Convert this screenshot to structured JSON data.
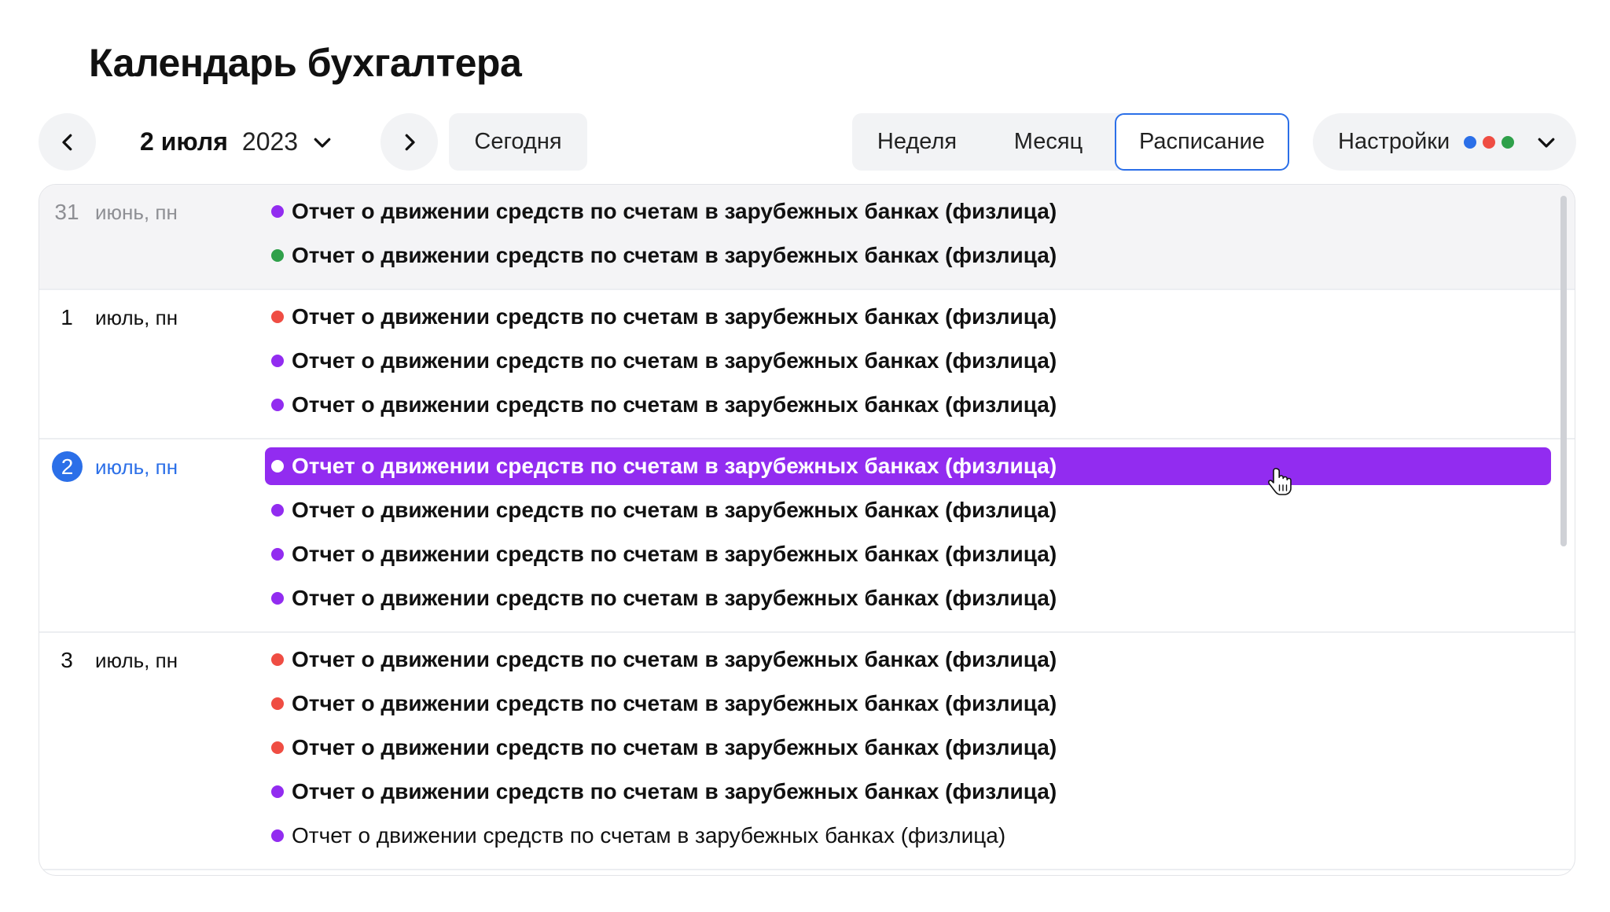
{
  "page": {
    "title": "Календарь бухгалтера"
  },
  "toolbar": {
    "prev_icon": "chevron-left-icon",
    "next_icon": "chevron-right-icon",
    "date": {
      "day_month": "2 июля",
      "year": "2023",
      "chevron_icon": "chevron-down-icon"
    },
    "today_label": "Сегодня",
    "views": [
      {
        "label": "Неделя",
        "active": false
      },
      {
        "label": "Месяц",
        "active": false
      },
      {
        "label": "Расписание",
        "active": true
      }
    ],
    "settings": {
      "label": "Настройки",
      "dot_colors": [
        "#2b6fe8",
        "#ef4d43",
        "#2fa04a"
      ],
      "chevron_icon": "chevron-down-icon"
    }
  },
  "colors": {
    "purple": "#922cf0",
    "green": "#2fa04a",
    "red": "#ef4d43",
    "accent": "#2b6fe8",
    "selected_bg": "#922cf0"
  },
  "days": [
    {
      "num": "31",
      "label": "июнь, пн",
      "state": "past",
      "events": [
        {
          "title": "Отчет о движении средств по счетам в зарубежных банках (физлица)",
          "color": "purple"
        },
        {
          "title": "Отчет о движении средств по счетам в зарубежных банках (физлица)",
          "color": "green"
        }
      ]
    },
    {
      "num": "1",
      "label": "июль, пн",
      "state": "normal",
      "events": [
        {
          "title": "Отчет о движении средств по счетам в зарубежных банках (физлица)",
          "color": "red"
        },
        {
          "title": "Отчет о движении средств по счетам в зарубежных банках (физлица)",
          "color": "purple"
        },
        {
          "title": "Отчет о движении средств по счетам в зарубежных банках (физлица)",
          "color": "purple"
        }
      ]
    },
    {
      "num": "2",
      "label": "июль, пн",
      "state": "today",
      "events": [
        {
          "title": "Отчет о движении средств по счетам в зарубежных банках (физлица)",
          "color": "purple",
          "selected": true
        },
        {
          "title": "Отчет о движении средств по счетам в зарубежных банках (физлица)",
          "color": "purple"
        },
        {
          "title": "Отчет о движении средств по счетам в зарубежных банках (физлица)",
          "color": "purple"
        },
        {
          "title": "Отчет о движении средств по счетам в зарубежных банках (физлица)",
          "color": "purple"
        }
      ]
    },
    {
      "num": "3",
      "label": "июль, пн",
      "state": "normal",
      "events": [
        {
          "title": "Отчет о движении средств по счетам в зарубежных банках (физлица)",
          "color": "red"
        },
        {
          "title": "Отчет о движении средств по счетам в зарубежных банках (физлица)",
          "color": "red"
        },
        {
          "title": "Отчет о движении средств по счетам в зарубежных банках (физлица)",
          "color": "red"
        },
        {
          "title": "Отчет о движении средств по счетам в зарубежных банках (физлица)",
          "color": "purple"
        },
        {
          "title": "Отчет о движении средств по счетам в зарубежных банках (физлица)",
          "color": "purple",
          "weight": "normal"
        }
      ]
    }
  ]
}
